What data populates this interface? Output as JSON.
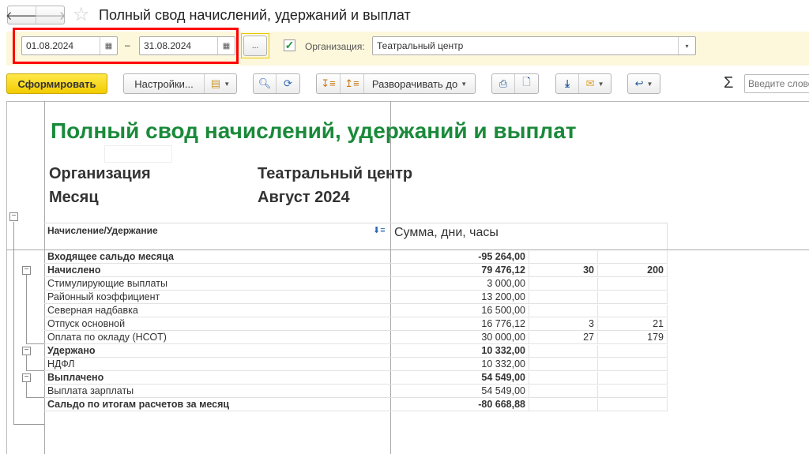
{
  "window": {
    "title": "Полный свод начислений, удержаний и выплат"
  },
  "filters": {
    "date_from": "01.08.2024",
    "date_to": "31.08.2024",
    "dash": "–",
    "more_label": "...",
    "org_checked": true,
    "org_label": "Организация:",
    "org_value": "Театральный центр"
  },
  "toolbar": {
    "generate": "Сформировать",
    "settings": "Настройки...",
    "expand_to": "Разворачивать до",
    "search_placeholder": "Введите слово",
    "sigma": "Σ"
  },
  "report": {
    "title": "Полный свод начислений, удержаний и выплат",
    "params": [
      {
        "label": "Организация",
        "value": "Театральный центр"
      },
      {
        "label": "Месяц",
        "value": "Август 2024"
      }
    ],
    "col1_header": "Начисление/Удержание",
    "col2_header": "Сумма, дни, часы",
    "rows": [
      {
        "name": "Входящее сальдо месяца",
        "sum": "-95 264,00",
        "days": "",
        "hours": "",
        "bold": true
      },
      {
        "name": "Начислено",
        "sum": "79 476,12",
        "days": "30",
        "hours": "200",
        "bold": true
      },
      {
        "name": "Стимулирующие выплаты",
        "sum": "3 000,00",
        "days": "",
        "hours": "",
        "bold": false
      },
      {
        "name": "Районный коэффициент",
        "sum": "13 200,00",
        "days": "",
        "hours": "",
        "bold": false
      },
      {
        "name": "Северная надбавка",
        "sum": "16 500,00",
        "days": "",
        "hours": "",
        "bold": false
      },
      {
        "name": "Отпуск основной",
        "sum": "16 776,12",
        "days": "3",
        "hours": "21",
        "bold": false
      },
      {
        "name": "Оплата по окладу (НСОТ)",
        "sum": "30 000,00",
        "days": "27",
        "hours": "179",
        "bold": false
      },
      {
        "name": "Удержано",
        "sum": "10 332,00",
        "days": "",
        "hours": "",
        "bold": true
      },
      {
        "name": "НДФЛ",
        "sum": "10 332,00",
        "days": "",
        "hours": "",
        "bold": false
      },
      {
        "name": "Выплачено",
        "sum": "54 549,00",
        "days": "",
        "hours": "",
        "bold": true
      },
      {
        "name": "Выплата зарплаты",
        "sum": "54 549,00",
        "days": "",
        "hours": "",
        "bold": false
      },
      {
        "name": "Сальдо по итогам расчетов за месяц",
        "sum": "-80 668,88",
        "days": "",
        "hours": "",
        "bold": true
      }
    ]
  }
}
